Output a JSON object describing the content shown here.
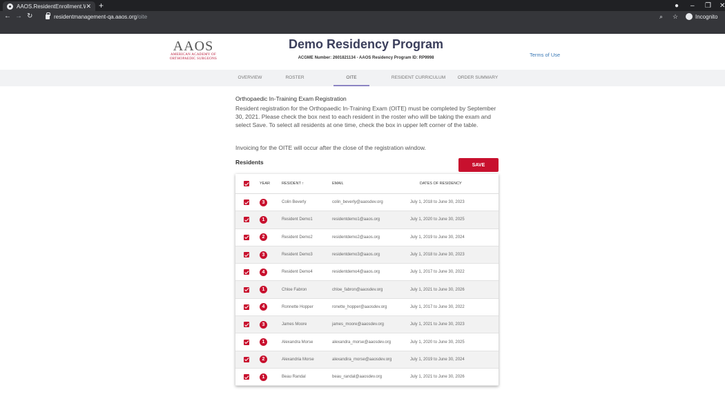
{
  "browser": {
    "tab_title": "AAOS.ResidentEnrollment.Web",
    "url_host": "residentmanagement-qa.aaos.org",
    "url_path": "/oite",
    "incognito_label": "Incognito"
  },
  "header": {
    "logo_mark": "AAOS",
    "logo_line1": "American Academy of",
    "logo_line2": "Orthopaedic Surgeons",
    "program_title": "Demo Residency Program",
    "program_meta": "ACGME Number: 2601821134  -  AAOS Residency Program ID: RP9998",
    "terms_link": "Terms of Use"
  },
  "tabs": [
    {
      "label": "Overview"
    },
    {
      "label": "Roster"
    },
    {
      "label": "OITE"
    },
    {
      "label": "Resident Curriculum"
    },
    {
      "label": "Order Summary"
    }
  ],
  "content": {
    "section_title": "Orthopaedic In-Training Exam Registration",
    "paragraph1": "Resident registration for the Orthopaedic In-Training Exam (OITE) must be completed by September 30, 2021. Please check the box next to each resident in the roster who will be taking the exam and select Save. To select all residents at one time, check the box in upper left corner of the table.",
    "paragraph2": "Invoicing for the OITE will occur after the close of the registration window.",
    "residents_label": "Residents",
    "save_label": "SAVE"
  },
  "table": {
    "columns": {
      "year": "YEAR",
      "resident": "RESIDENT ↑",
      "email": "EMAIL",
      "dates": "DATES OF RESIDENCY"
    },
    "rows": [
      {
        "year": "3",
        "name": "Colin Beverly",
        "email": "colin_beverly@aaosdev.org",
        "dates": "July 1, 2018 to June 30, 2023"
      },
      {
        "year": "1",
        "name": "Resident Demo1",
        "email": "residentdemo1@aaos.org",
        "dates": "July 1, 2020 to June 30, 2025"
      },
      {
        "year": "2",
        "name": "Resident Demo2",
        "email": "residentdemo2@aaos.org",
        "dates": "July 1, 2019 to June 30, 2024"
      },
      {
        "year": "3",
        "name": "Resident Demo3",
        "email": "residentdemo3@aaos.org",
        "dates": "July 1, 2018 to June 30, 2023"
      },
      {
        "year": "4",
        "name": "Resident Demo4",
        "email": "residentdemo4@aaos.org",
        "dates": "July 1, 2017 to June 30, 2022"
      },
      {
        "year": "1",
        "name": "Chloe Fabron",
        "email": "chloe_fabron@aaosdev.org",
        "dates": "July 1, 2021 to June 30, 2026"
      },
      {
        "year": "4",
        "name": "Ronnette Hopper",
        "email": "ronette_hopper@aaosdev.org",
        "dates": "July 1, 2017 to June 30, 2022"
      },
      {
        "year": "3",
        "name": "James Moore",
        "email": "james_moore@aaosdev.org",
        "dates": "July 1, 2021 to June 30, 2023"
      },
      {
        "year": "1",
        "name": "Alexandra Morse",
        "email": "alexandra_morse@aaosdev.org",
        "dates": "July 1, 2020 to June 30, 2025"
      },
      {
        "year": "2",
        "name": "Alexandria Morse",
        "email": "alexandira_morse@aaosdev.org",
        "dates": "July 1, 2019 to June 30, 2024"
      },
      {
        "year": "1",
        "name": "Beau Randal",
        "email": "beau_randal@aaosdev.org",
        "dates": "July 1, 2021 to June 30, 2026"
      }
    ]
  },
  "colors": {
    "accent": "#c8102e",
    "tab_underline": "#8b84c3",
    "title": "#3b3f5c",
    "link": "#3a78b5"
  }
}
